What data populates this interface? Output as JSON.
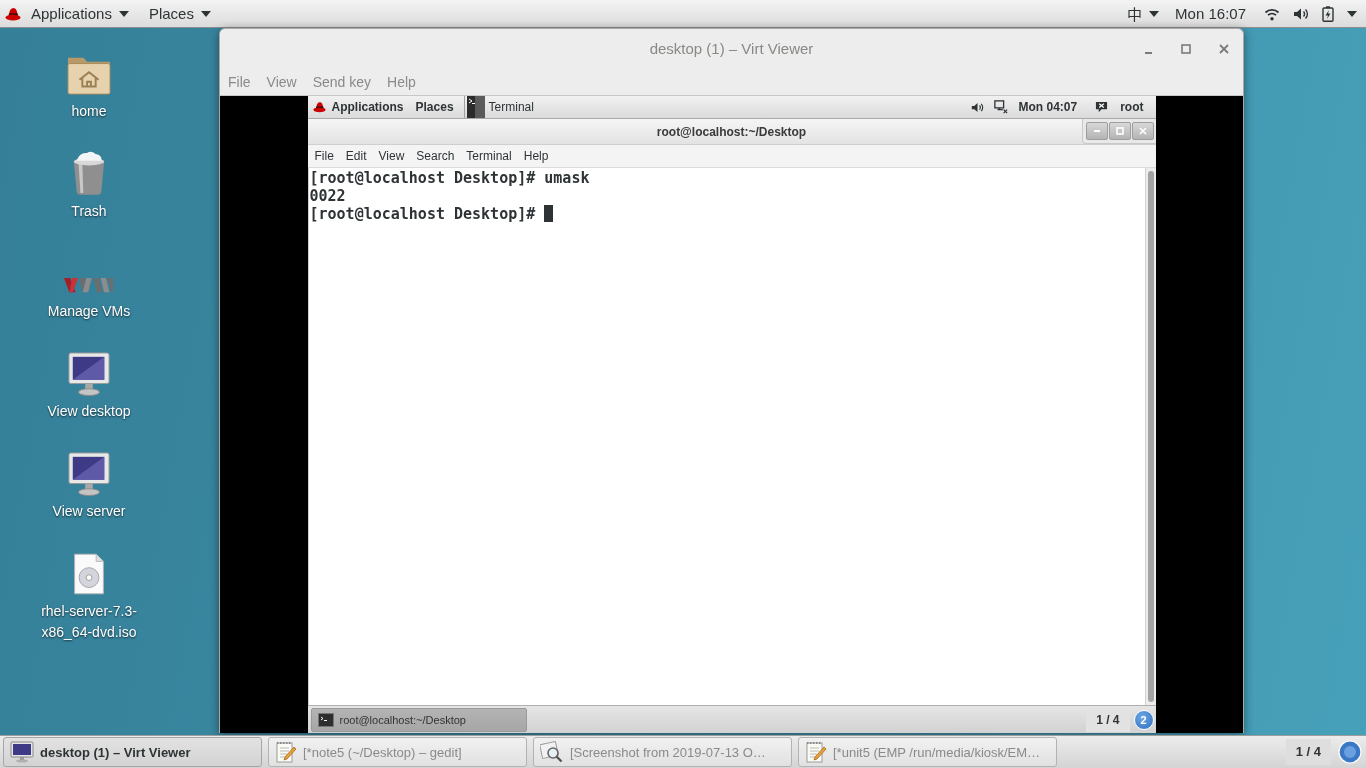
{
  "top_bar": {
    "menus": [
      "Applications",
      "Places"
    ],
    "input_method": "中",
    "clock": "Mon 16:07"
  },
  "desktop": {
    "icons": [
      {
        "label": "home",
        "kind": "folder"
      },
      {
        "label": "Trash",
        "kind": "trash"
      },
      {
        "label": "Manage VMs",
        "kind": "vm"
      },
      {
        "label": "View desktop",
        "kind": "monitor"
      },
      {
        "label": "View server",
        "kind": "monitor"
      },
      {
        "label": "rhel-server-7.3-x86_64-dvd.iso",
        "kind": "disc"
      }
    ]
  },
  "viewer_window": {
    "title": "desktop (1) – Virt Viewer",
    "menu": [
      "File",
      "View",
      "Send key",
      "Help"
    ],
    "guest": {
      "top_bar": {
        "menus": [
          "Applications",
          "Places"
        ],
        "app": "Terminal",
        "clock": "Mon 04:07",
        "user": "root"
      },
      "terminal": {
        "title": "root@localhost:~/Desktop",
        "menu": [
          "File",
          "Edit",
          "View",
          "Search",
          "Terminal",
          "Help"
        ],
        "lines": [
          "[root@localhost Desktop]# umask",
          "0022",
          "[root@localhost Desktop]#"
        ]
      },
      "bottom_bar": {
        "windows": [
          {
            "label": "root@localhost:~/Desktop",
            "selected": true
          }
        ],
        "workspace": "1 / 4",
        "notifications": "2"
      }
    }
  },
  "taskbar": {
    "windows": [
      {
        "label": "desktop (1) – Virt Viewer",
        "kind": "monitor",
        "selected": true
      },
      {
        "label": "[*note5 (~/Desktop) – gedit]",
        "kind": "notepad",
        "selected": false
      },
      {
        "label": "[Screenshot from 2019-07-13 O…",
        "kind": "viewer",
        "selected": false
      },
      {
        "label": "[*unit5 (EMP /run/media/kiosk/EM…",
        "kind": "notepad",
        "selected": false
      }
    ],
    "workspace": "1 / 4"
  }
}
